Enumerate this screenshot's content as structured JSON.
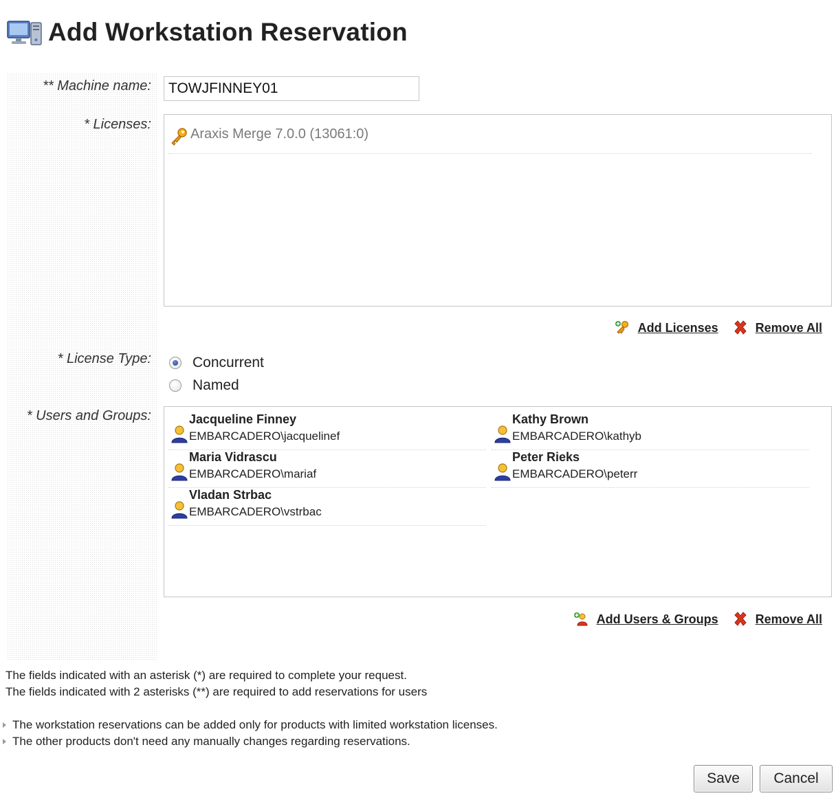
{
  "header": {
    "title": "Add Workstation Reservation",
    "icon": "workstation-icon"
  },
  "form": {
    "machine_name_label": "** Machine name:",
    "machine_name_value": "TOWJFINNEY01",
    "licenses_label": "* Licenses:",
    "licenses": [
      {
        "name": "Araxis Merge 7.0.0 (13061:0)",
        "icon": "key-icon"
      }
    ],
    "licenses_actions": {
      "add": "Add Licenses",
      "remove": "Remove All"
    },
    "license_type_label": "* License Type:",
    "license_type_options": [
      {
        "label": "Concurrent",
        "checked": true
      },
      {
        "label": "Named",
        "checked": false
      }
    ],
    "users_label": "* Users and Groups:",
    "users": [
      {
        "name": "Jacqueline Finney",
        "account": "EMBARCADERO\\jacquelinef"
      },
      {
        "name": "Kathy Brown",
        "account": "EMBARCADERO\\kathyb"
      },
      {
        "name": "Maria Vidrascu",
        "account": "EMBARCADERO\\mariaf"
      },
      {
        "name": "Peter Rieks",
        "account": "EMBARCADERO\\peterr"
      },
      {
        "name": "Vladan Strbac",
        "account": "EMBARCADERO\\vstrbac"
      }
    ],
    "users_actions": {
      "add": "Add Users & Groups",
      "remove": "Remove All"
    }
  },
  "notes": {
    "line1": "The fields indicated with an asterisk (*) are required to complete your request.",
    "line2": "The fields indicated with 2 asterisks (**) are required to add reservations for users"
  },
  "bullets": {
    "item1": "The workstation reservations can be added only for products with limited workstation licenses.",
    "item2": "The other products don't need any manually changes regarding reservations."
  },
  "buttons": {
    "save": "Save",
    "cancel": "Cancel"
  },
  "colors": {
    "accent_orange": "#e8a01a",
    "remove_red": "#d9361e",
    "user_blue": "#2c3fa3"
  }
}
